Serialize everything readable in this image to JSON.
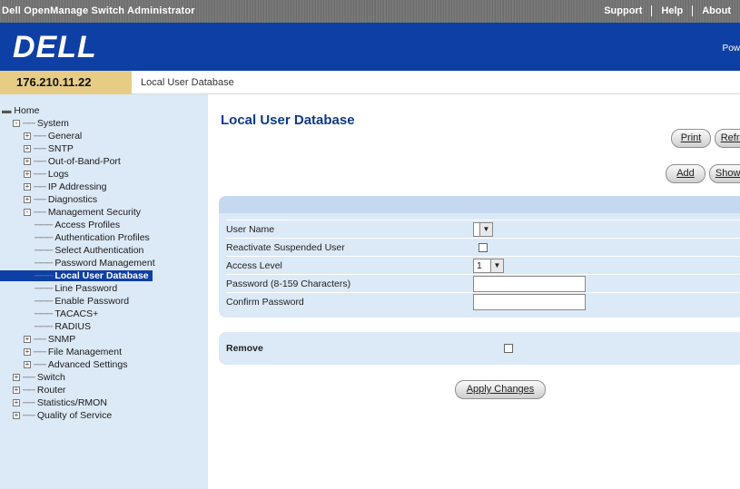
{
  "app": {
    "title": "Dell OpenManage Switch Administrator"
  },
  "toplinks": [
    "Support",
    "Help",
    "About"
  ],
  "banner": {
    "logo": "DELL",
    "right_text": "Pow"
  },
  "infobar": {
    "ip": "176.210.11.22",
    "breadcrumb": "Local User Database"
  },
  "tree": [
    {
      "label": "Home",
      "toggle": "",
      "selected": false
    },
    {
      "label": "System",
      "toggle": "-",
      "selected": false
    },
    {
      "label": "General",
      "toggle": "+",
      "selected": false
    },
    {
      "label": "SNTP",
      "toggle": "+",
      "selected": false
    },
    {
      "label": "Out-of-Band-Port",
      "toggle": "+",
      "selected": false
    },
    {
      "label": "Logs",
      "toggle": "+",
      "selected": false
    },
    {
      "label": "IP Addressing",
      "toggle": "+",
      "selected": false
    },
    {
      "label": "Diagnostics",
      "toggle": "+",
      "selected": false
    },
    {
      "label": "Management Security",
      "toggle": "-",
      "selected": false
    },
    {
      "label": "Access Profiles",
      "toggle": "",
      "selected": false
    },
    {
      "label": "Authentication Profiles",
      "toggle": "",
      "selected": false
    },
    {
      "label": "Select Authentication",
      "toggle": "",
      "selected": false
    },
    {
      "label": "Password Management",
      "toggle": "",
      "selected": false
    },
    {
      "label": "Local User Database",
      "toggle": "",
      "selected": true
    },
    {
      "label": "Line Password",
      "toggle": "",
      "selected": false
    },
    {
      "label": "Enable Password",
      "toggle": "",
      "selected": false
    },
    {
      "label": "TACACS+",
      "toggle": "",
      "selected": false
    },
    {
      "label": "RADIUS",
      "toggle": "",
      "selected": false
    },
    {
      "label": "SNMP",
      "toggle": "+",
      "selected": false
    },
    {
      "label": "File Management",
      "toggle": "+",
      "selected": false
    },
    {
      "label": "Advanced Settings",
      "toggle": "+",
      "selected": false
    },
    {
      "label": "Switch",
      "toggle": "+",
      "selected": false
    },
    {
      "label": "Router",
      "toggle": "+",
      "selected": false
    },
    {
      "label": "Statistics/RMON",
      "toggle": "+",
      "selected": false
    },
    {
      "label": "Quality of Service",
      "toggle": "+",
      "selected": false
    }
  ],
  "main": {
    "title": "Local User Database",
    "buttons": {
      "print": "Print",
      "refresh": "Refresh",
      "add": "Add",
      "show_all": "Show All",
      "apply": "Apply Changes"
    },
    "form": {
      "user_name_label": "User Name",
      "user_name_value": "",
      "reactivate_label": "Reactivate Suspended User",
      "reactivate_checked": false,
      "access_level_label": "Access Level",
      "access_level_value": "1",
      "password_label": "Password (8-159 Characters)",
      "password_value": "",
      "confirm_label": "Confirm Password",
      "confirm_value": ""
    },
    "remove": {
      "label": "Remove",
      "checked": false
    }
  }
}
